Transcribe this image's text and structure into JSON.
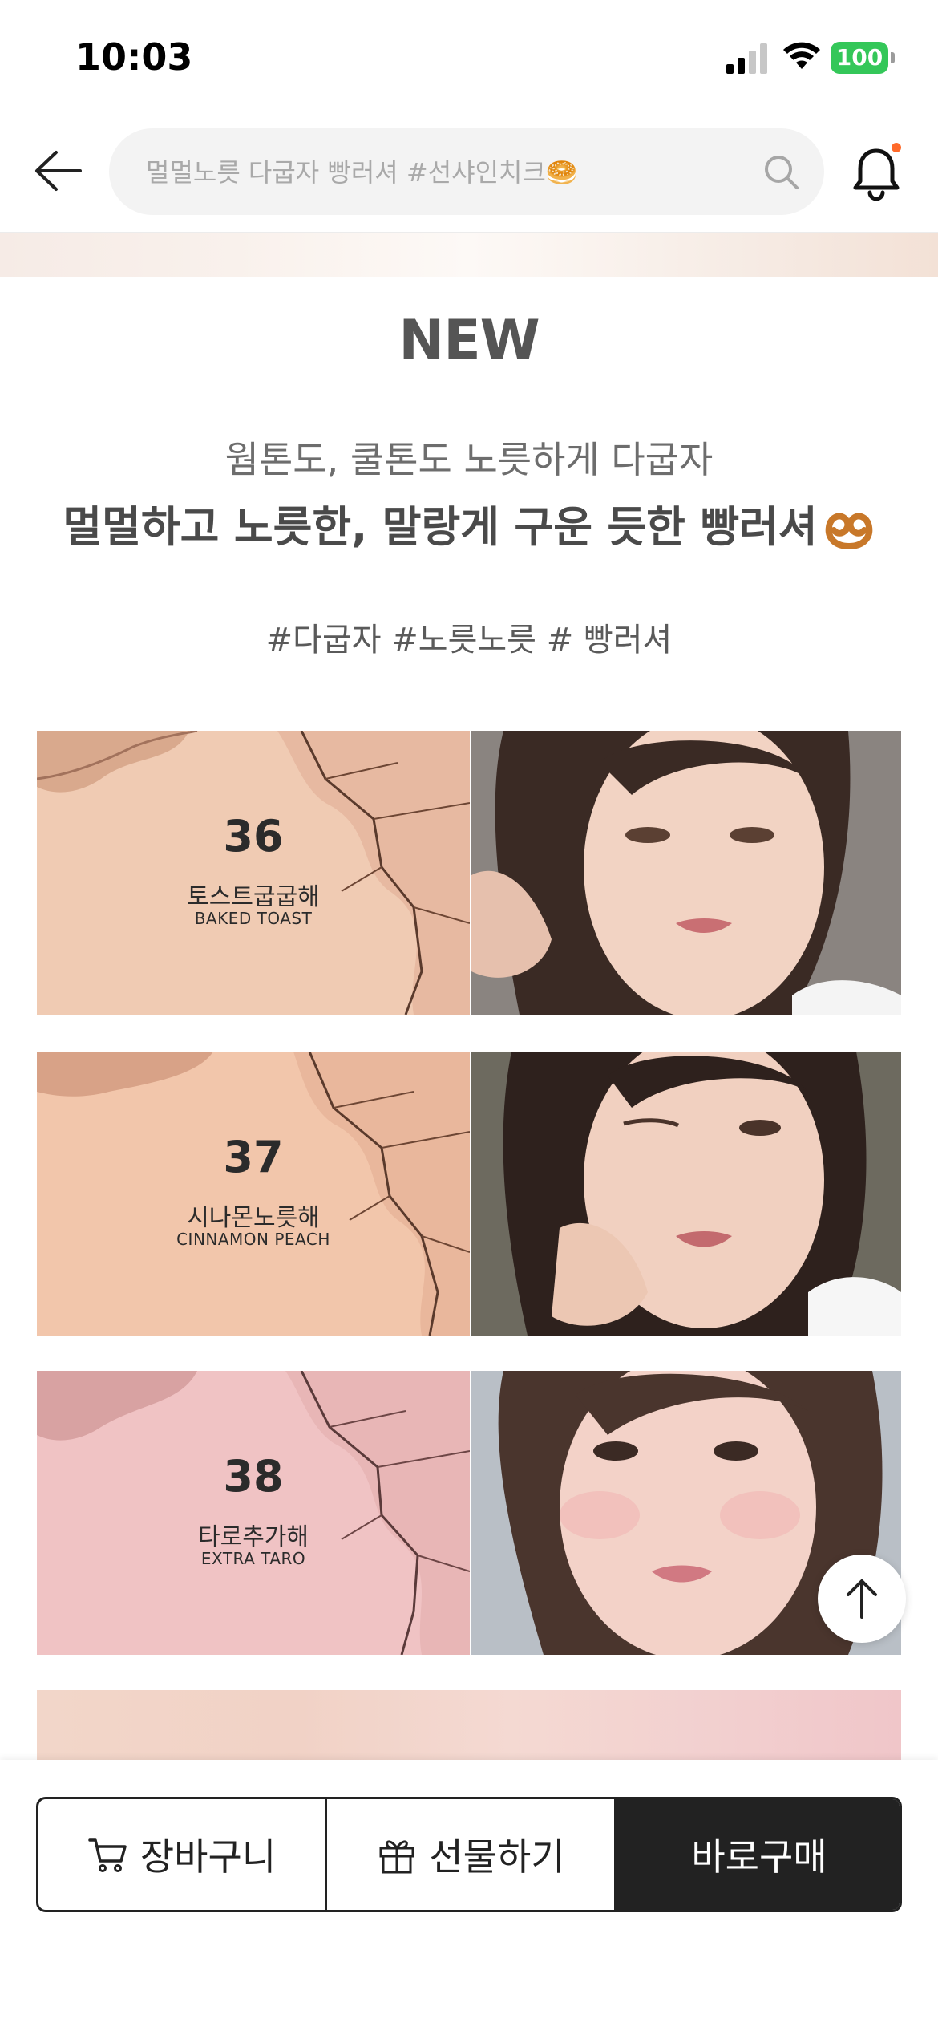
{
  "status_bar": {
    "time": "10:03",
    "battery": "100"
  },
  "header": {
    "search_placeholder": "멀멀노릇 다굽자 빵러셔 #선샤인치크🥯",
    "icons": [
      "back-arrow-icon",
      "search-icon",
      "bell-icon"
    ],
    "notification_dot_color": "#ff6a2a"
  },
  "content": {
    "title": "NEW",
    "subtitle_line1": "웜톤도, 쿨톤도 노릇하게 다굽자",
    "subtitle_line2": "멀멀하고 노릇한, 말랑게 구운 듯한 빵러셔",
    "hashtags": "#다굽자 #노릇노릇 # 빵러셔",
    "shades": [
      {
        "number": "36",
        "name_ko": "토스트굽굽해",
        "name_en": "BAKED TOAST",
        "color": "#f0cbb3"
      },
      {
        "number": "37",
        "name_ko": "시나몬노릇해",
        "name_en": "CINNAMON PEACH",
        "color": "#f2c6ab"
      },
      {
        "number": "38",
        "name_ko": "타로추가해",
        "name_en": "EXTRA TARO",
        "color": "#f0c3c4"
      }
    ]
  },
  "bottom_bar": {
    "cart_label": "장바구니",
    "gift_label": "선물하기",
    "buy_label": "바로구매"
  }
}
